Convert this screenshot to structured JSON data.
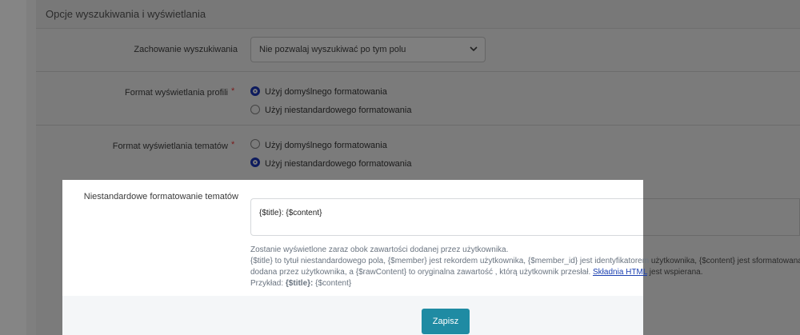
{
  "panel": {
    "title": "Opcje wyszukiwania i wyświetlania"
  },
  "search_behavior": {
    "label": "Zachowanie wyszukiwania",
    "selected": "Nie pozwalaj wyszukiwać po tym polu"
  },
  "profile_format": {
    "label": "Format wyświetlania profili",
    "required_mark": "*",
    "options": [
      "Użyj domyślnego formatowania",
      "Użyj niestandardowego formatowania"
    ],
    "selected_index": 0
  },
  "topic_format": {
    "label": "Format wyświetlania tematów",
    "required_mark": "*",
    "options": [
      "Użyj domyślnego formatowania",
      "Użyj niestandardowego formatowania"
    ],
    "selected_index": 1
  },
  "custom_topic_format": {
    "label": "Niestandardowe formatowanie tematów",
    "value": "{$title}: {$content}",
    "help_line1": "Zostanie wyświetlone zaraz obok zawartości dodanej przez użytkownika.",
    "help_line2_left": "{$title} to tytuł niestandardowego pola, {$member} jest rekordem użytkownika, {$member_id} jest identyfikatorem",
    "help_line2_right": "użytkownika, {$content} jest sformatowaną z",
    "help_line3_pre": "dodana przez użytkownika, a {$rawContent} to oryginalna zawartość , którą użytkownik przesłał.",
    "help_line3_link": "Składnia HTML",
    "help_line3_post": "jest wspierana.",
    "example_label": "Przykład:",
    "example_title": "{$title}:",
    "example_content": "{$content}"
  },
  "save_button": "Zapisz"
}
